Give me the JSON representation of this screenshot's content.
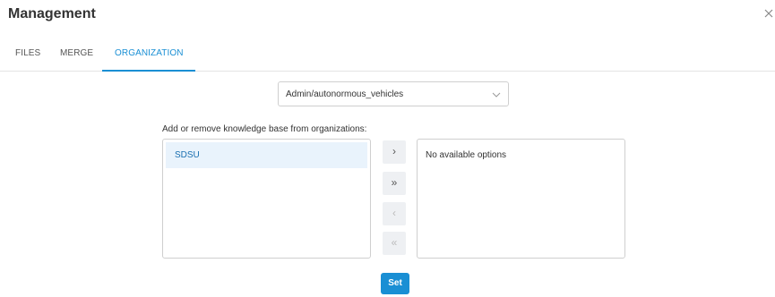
{
  "modal": {
    "title": "Management"
  },
  "tabs": [
    {
      "label": "FILES"
    },
    {
      "label": "MERGE"
    },
    {
      "label": "ORGANIZATION",
      "active": true
    }
  ],
  "kb_select": {
    "value": "Admin/autonormous_vehicles"
  },
  "transfer": {
    "instruction": "Add or remove knowledge base from organizations:",
    "available": [
      "SDSU"
    ],
    "selected_empty_text": "No available options",
    "buttons": [
      {
        "label": "›",
        "name": "move-right"
      },
      {
        "label": "»",
        "name": "move-all-right"
      },
      {
        "label": "‹",
        "name": "move-left"
      },
      {
        "label": "«",
        "name": "move-all-left"
      }
    ]
  },
  "actions": {
    "set_label": "Set"
  },
  "colors": {
    "accent": "#1a8fd4",
    "selected_bg": "#e9f3fc"
  }
}
